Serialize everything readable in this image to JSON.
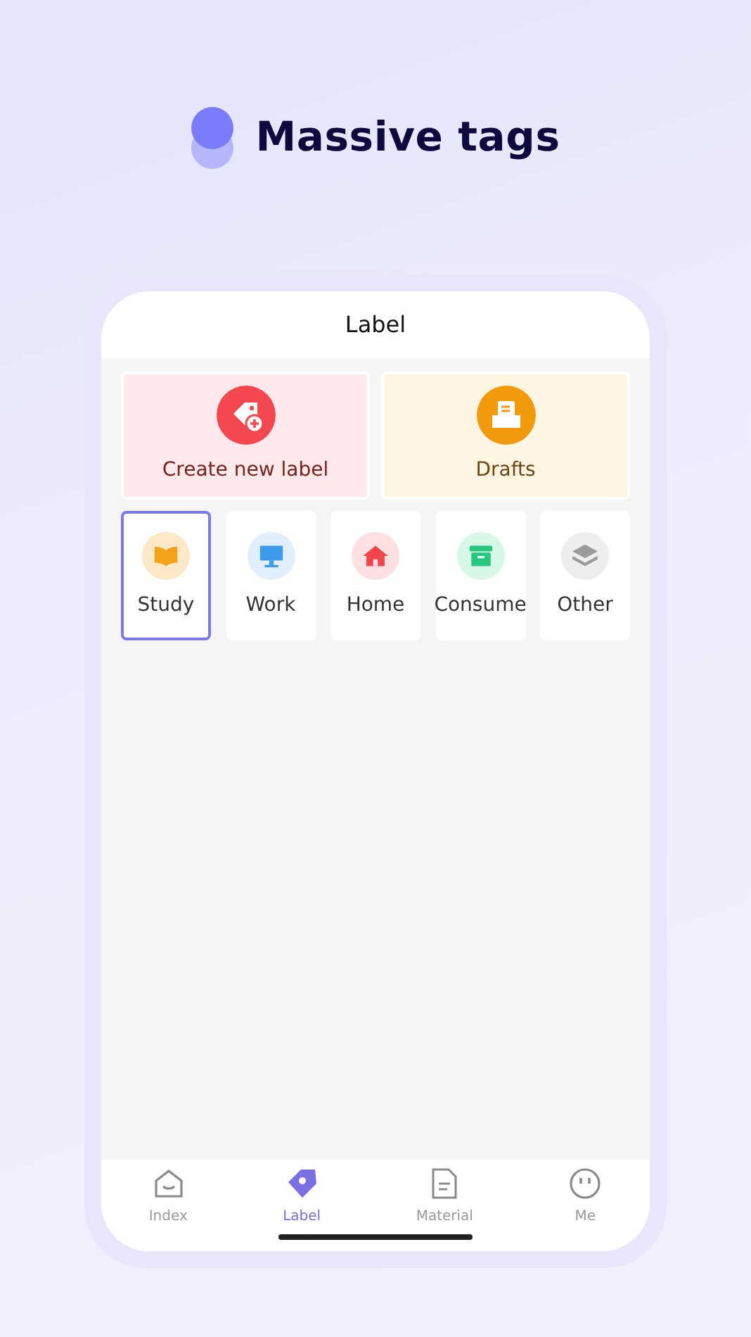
{
  "headline": "Massive tags",
  "screen": {
    "title": "Label"
  },
  "actions": [
    {
      "kind": "create",
      "label": "Create new label"
    },
    {
      "kind": "drafts",
      "label": "Drafts"
    }
  ],
  "categories": [
    {
      "kind": "study",
      "label": "Study",
      "selected": true
    },
    {
      "kind": "work",
      "label": "Work",
      "selected": false
    },
    {
      "kind": "home",
      "label": "Home",
      "selected": false
    },
    {
      "kind": "consume",
      "label": "Consume",
      "selected": false
    },
    {
      "kind": "other",
      "label": "Other",
      "selected": false
    }
  ],
  "tabs": [
    {
      "kind": "index",
      "label": "Index",
      "selected": false
    },
    {
      "kind": "label",
      "label": "Label",
      "selected": true
    },
    {
      "kind": "material",
      "label": "Material",
      "selected": false
    },
    {
      "kind": "me",
      "label": "Me",
      "selected": false
    }
  ]
}
